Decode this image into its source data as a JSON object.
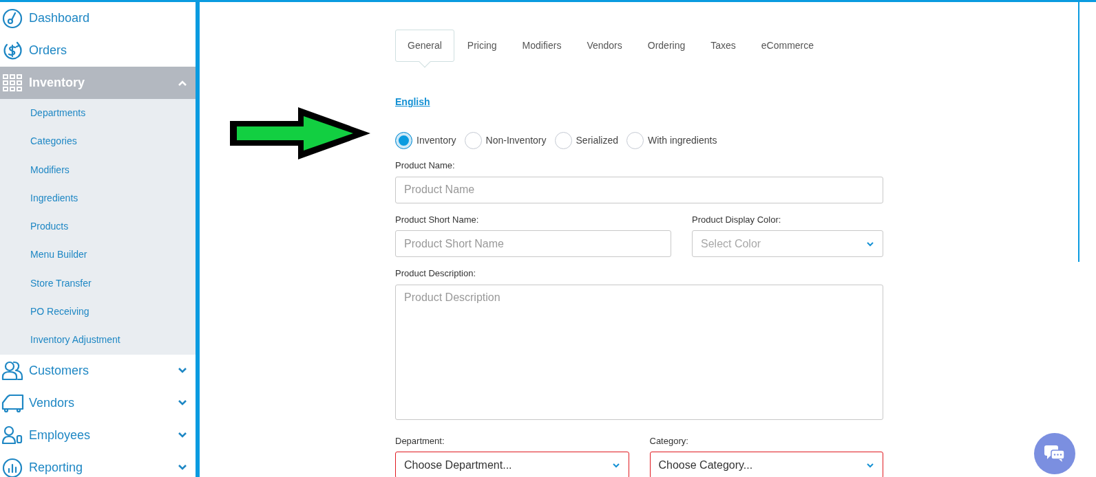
{
  "sidebar": {
    "items": [
      {
        "label": "Dashboard",
        "selected": false
      },
      {
        "label": "Orders",
        "selected": false
      },
      {
        "label": "Inventory",
        "selected": true,
        "expanded": true,
        "children": [
          {
            "label": "Departments"
          },
          {
            "label": "Categories"
          },
          {
            "label": "Modifiers"
          },
          {
            "label": "Ingredients"
          },
          {
            "label": "Products"
          },
          {
            "label": "Menu Builder"
          },
          {
            "label": "Store Transfer"
          },
          {
            "label": "PO Receiving"
          },
          {
            "label": "Inventory Adjustment"
          }
        ]
      },
      {
        "label": "Customers",
        "selected": false,
        "expanded": false
      },
      {
        "label": "Vendors",
        "selected": false,
        "expanded": false
      },
      {
        "label": "Employees",
        "selected": false,
        "expanded": false
      },
      {
        "label": "Reporting",
        "selected": false,
        "expanded": false
      }
    ]
  },
  "tabs": [
    {
      "label": "General",
      "selected": true
    },
    {
      "label": "Pricing",
      "selected": false
    },
    {
      "label": "Modifiers",
      "selected": false
    },
    {
      "label": "Vendors",
      "selected": false
    },
    {
      "label": "Ordering",
      "selected": false
    },
    {
      "label": "Taxes",
      "selected": false
    },
    {
      "label": "eCommerce",
      "selected": false
    }
  ],
  "language_link": "English",
  "product_types": [
    {
      "label": "Inventory",
      "selected": true
    },
    {
      "label": "Non-Inventory",
      "selected": false
    },
    {
      "label": "Serialized",
      "selected": false
    },
    {
      "label": "With ingredients",
      "selected": false
    }
  ],
  "form_rows": [
    [
      {
        "kind": "text",
        "label": "Product Name:",
        "placeholder": "Product Name",
        "invalid": false
      }
    ],
    [
      {
        "kind": "text",
        "label": "Product Short Name:",
        "placeholder": "Product Short Name",
        "invalid": false
      },
      {
        "kind": "select",
        "label": "Product Display Color:",
        "placeholder": "Select Color",
        "invalid": false
      }
    ],
    [
      {
        "kind": "textarea",
        "label": "Product Description:",
        "placeholder": "Product Description",
        "invalid": false
      }
    ],
    [
      {
        "kind": "select",
        "label": "Department:",
        "value": "Choose Department...",
        "invalid": true
      },
      {
        "kind": "select",
        "label": "Category:",
        "value": "Choose Category...",
        "invalid": true
      }
    ]
  ]
}
